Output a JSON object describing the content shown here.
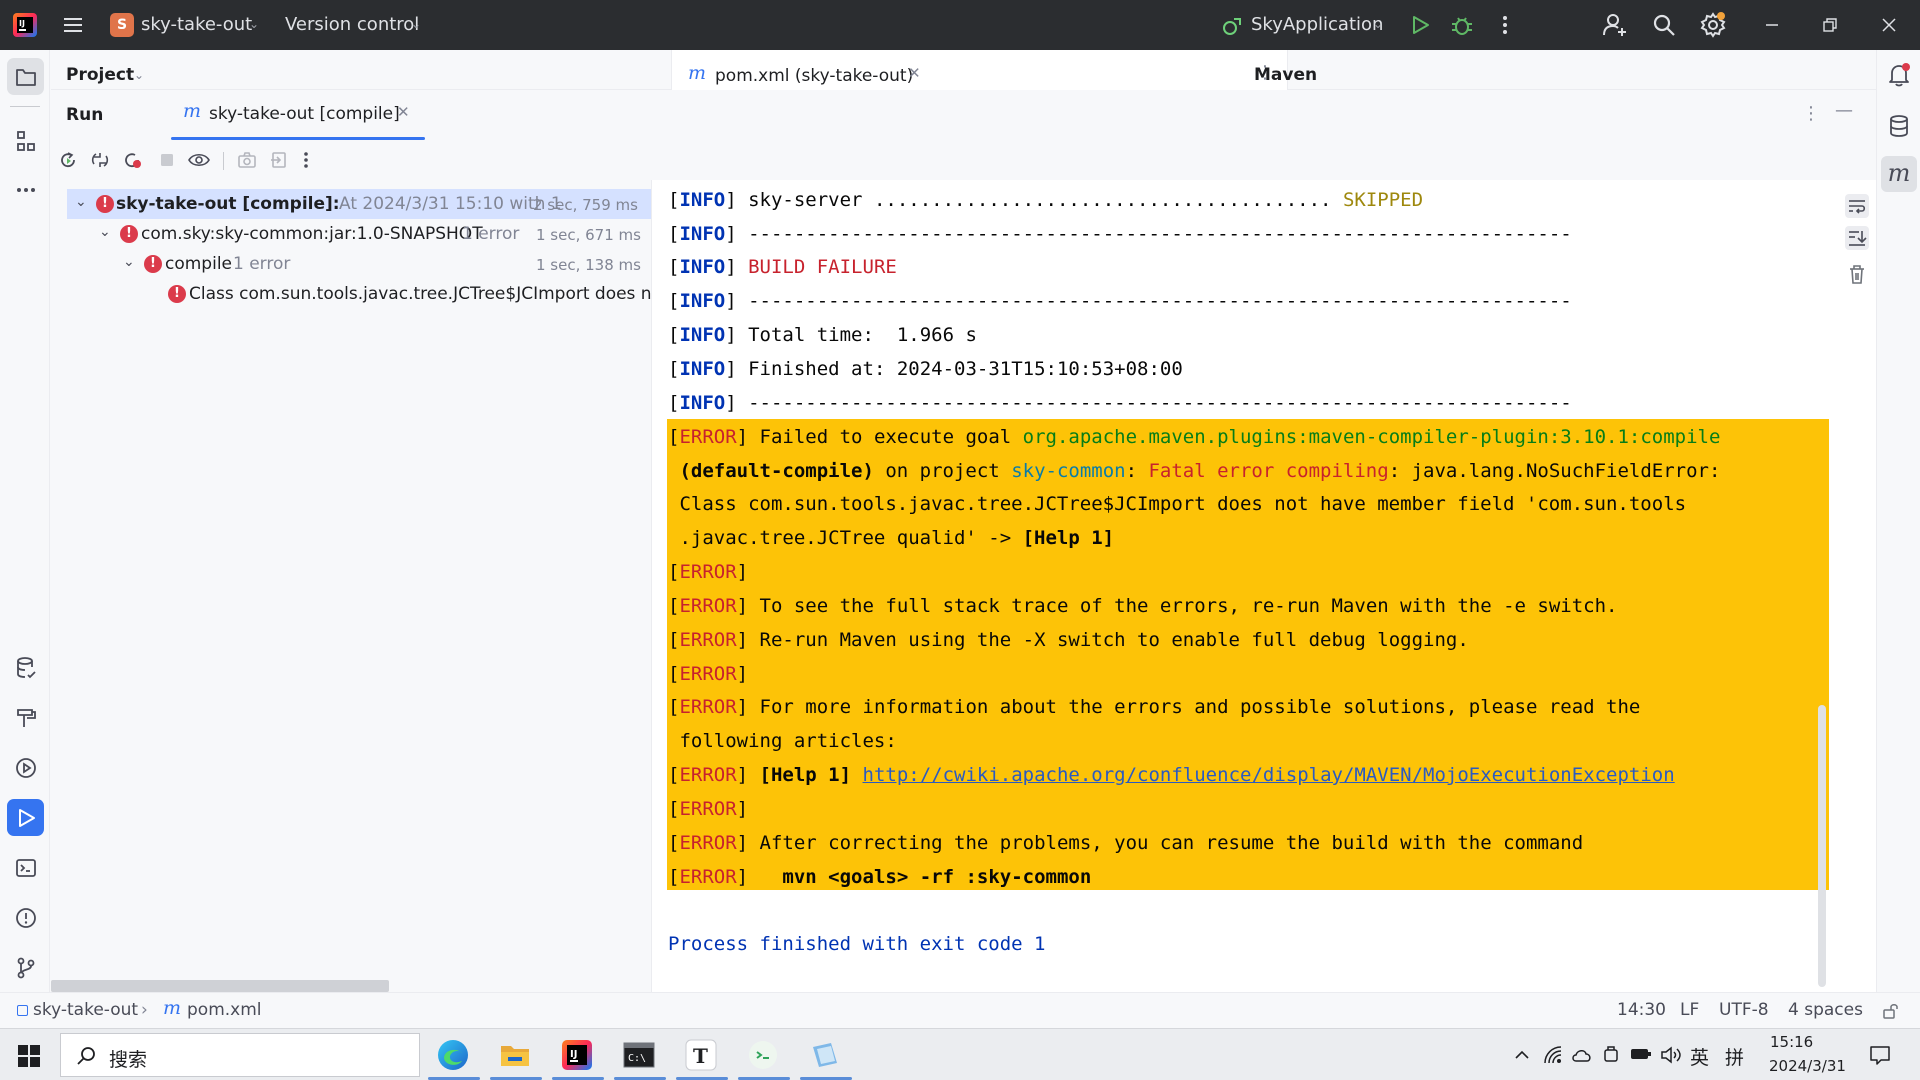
{
  "titlebar": {
    "project_name": "sky-take-out",
    "project_initial": "S",
    "vcs_label": "Version control",
    "run_config": "SkyApplication"
  },
  "left_stripe": {
    "items": [
      "project",
      "structure",
      "more",
      "database",
      "build",
      "services",
      "run",
      "terminal",
      "problems",
      "git"
    ]
  },
  "header": {
    "project_label": "Project",
    "editor_tab_label": "pom.xml (sky-take-out)",
    "maven_label": "Maven"
  },
  "run_window": {
    "title": "Run",
    "tab_label": "sky-take-out [compile]"
  },
  "tree": [
    {
      "label": "sky-take-out [compile]:",
      "meta": "At 2024/3/31 15:10 with 1 ",
      "time": "2 sec, 759 ms",
      "selected": true
    },
    {
      "label": "com.sky:sky-common:jar:1.0-SNAPSHOT",
      "meta": "1 error",
      "time": "1 sec, 671 ms"
    },
    {
      "label": "compile",
      "meta": "1 error",
      "time": "1 sec, 138 ms"
    },
    {
      "label": "Class com.sun.tools.javac.tree.JCTree$JCImport does not h",
      "meta": "",
      "time": ""
    }
  ],
  "console": {
    "info_tag": "INFO",
    "error_tag": "ERROR",
    "line_sky_server": " sky-server ........................................ ",
    "skipped": "SKIPPED",
    "dashes": " ------------------------------------------------------------------------",
    "build_failure": "BUILD FAILURE",
    "total_time": " Total time:  1.966 s",
    "finished_at": " Finished at: 2024-03-31T15:10:53+08:00",
    "err1_a": " Failed to execute goal ",
    "err1_goal": "org.apache.maven.plugins:maven-compiler-plugin:3.10.1:compile",
    "err1_b_bold": " (default-compile)",
    "err1_b_plain": " on project ",
    "err1_b_project": "sky-common",
    "err1_b_colon": ": ",
    "err1_b_fatal": "Fatal error compiling",
    "err1_b_rest": ": java.lang.NoSuchFieldError:",
    "err1_c": " Class com.sun.tools.javac.tree.JCTree$JCImport does not have member field 'com.sun.tools",
    "err1_d": " .javac.tree.JCTree qualid' -> ",
    "help1": "[Help 1]",
    "err_stack": " To see the full stack trace of the errors, re-run Maven with the -e switch.",
    "err_debug": " Re-run Maven using the -X switch to enable full debug logging.",
    "err_more_a": " For more information about the errors and possible solutions, please read the",
    "err_more_b": " following articles:",
    "help1_link": "http://cwiki.apache.org/confluence/display/MAVEN/MojoExecutionException",
    "err_resume": " After correcting the problems, you can resume the build with the command",
    "err_cmd": "   mvn <goals> -rf :sky-common",
    "process_finished": "Process finished with exit code 1"
  },
  "statusbar": {
    "breadcrumb_project": "sky-take-out",
    "breadcrumb_file": "pom.xml",
    "position": "14:30",
    "line_sep": "LF",
    "encoding": "UTF-8",
    "indent": "4 spaces"
  },
  "taskbar": {
    "search_placeholder": "搜索",
    "time": "15:16",
    "date": "2024/3/31",
    "ime_lang": "英",
    "ime_mode": "拼"
  },
  "colors": {
    "accent": "#3574f0",
    "error_highlight": "#fdc307",
    "error_red": "#db3b4b",
    "titlebar": "#2b2d30"
  }
}
